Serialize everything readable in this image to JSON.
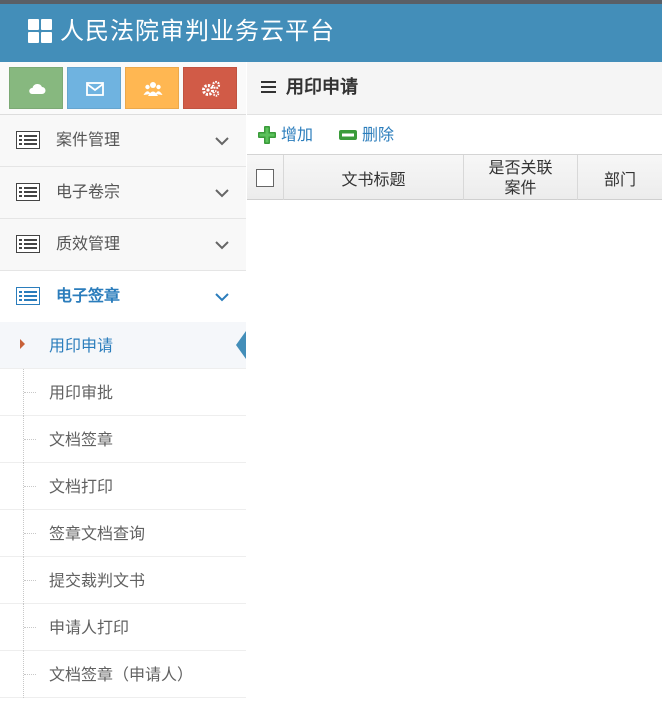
{
  "app": {
    "title": "人民法院审判业务云平台"
  },
  "shortcuts": [
    {
      "icon": "cloud-icon",
      "color": "#87b87f"
    },
    {
      "icon": "envelope-icon",
      "color": "#6fb3e0"
    },
    {
      "icon": "users-icon",
      "color": "#ffb752"
    },
    {
      "icon": "cogs-icon",
      "color": "#d15b47"
    }
  ],
  "sidebar": {
    "items": [
      {
        "label": "案件管理",
        "icon": "list-icon"
      },
      {
        "label": "电子卷宗",
        "icon": "list-icon"
      },
      {
        "label": "质效管理",
        "icon": "list-icon"
      },
      {
        "label": "电子签章",
        "icon": "list-icon",
        "active": true
      }
    ],
    "submenu": [
      {
        "label": "用印申请",
        "active": true
      },
      {
        "label": "用印审批"
      },
      {
        "label": "文档签章"
      },
      {
        "label": "文档打印"
      },
      {
        "label": "签章文档查询"
      },
      {
        "label": "提交裁判文书"
      },
      {
        "label": "申请人打印"
      },
      {
        "label": "文档签章（申请人）"
      }
    ]
  },
  "page": {
    "title": "用印申请"
  },
  "toolbar": {
    "add_label": "增加",
    "delete_label": "删除"
  },
  "grid": {
    "columns": [
      {
        "label": "文书标题"
      },
      {
        "label_line1": "是否关联",
        "label_line2": "案件"
      },
      {
        "label": "部门"
      }
    ],
    "rows": []
  },
  "colors": {
    "header_bg": "#438eb9",
    "accent": "#2b7dbc",
    "add_green": "#4caf50"
  }
}
